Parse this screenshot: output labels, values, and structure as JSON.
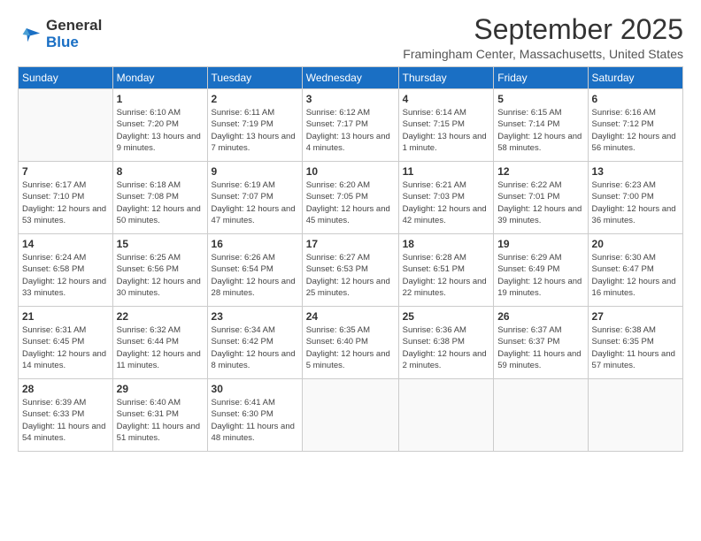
{
  "header": {
    "logo_text_general": "General",
    "logo_text_blue": "Blue",
    "month_title": "September 2025",
    "location": "Framingham Center, Massachusetts, United States"
  },
  "weekdays": [
    "Sunday",
    "Monday",
    "Tuesday",
    "Wednesday",
    "Thursday",
    "Friday",
    "Saturday"
  ],
  "weeks": [
    [
      {
        "day": "",
        "sunrise": "",
        "sunset": "",
        "daylight": ""
      },
      {
        "day": "1",
        "sunrise": "Sunrise: 6:10 AM",
        "sunset": "Sunset: 7:20 PM",
        "daylight": "Daylight: 13 hours and 9 minutes."
      },
      {
        "day": "2",
        "sunrise": "Sunrise: 6:11 AM",
        "sunset": "Sunset: 7:19 PM",
        "daylight": "Daylight: 13 hours and 7 minutes."
      },
      {
        "day": "3",
        "sunrise": "Sunrise: 6:12 AM",
        "sunset": "Sunset: 7:17 PM",
        "daylight": "Daylight: 13 hours and 4 minutes."
      },
      {
        "day": "4",
        "sunrise": "Sunrise: 6:14 AM",
        "sunset": "Sunset: 7:15 PM",
        "daylight": "Daylight: 13 hours and 1 minute."
      },
      {
        "day": "5",
        "sunrise": "Sunrise: 6:15 AM",
        "sunset": "Sunset: 7:14 PM",
        "daylight": "Daylight: 12 hours and 58 minutes."
      },
      {
        "day": "6",
        "sunrise": "Sunrise: 6:16 AM",
        "sunset": "Sunset: 7:12 PM",
        "daylight": "Daylight: 12 hours and 56 minutes."
      }
    ],
    [
      {
        "day": "7",
        "sunrise": "Sunrise: 6:17 AM",
        "sunset": "Sunset: 7:10 PM",
        "daylight": "Daylight: 12 hours and 53 minutes."
      },
      {
        "day": "8",
        "sunrise": "Sunrise: 6:18 AM",
        "sunset": "Sunset: 7:08 PM",
        "daylight": "Daylight: 12 hours and 50 minutes."
      },
      {
        "day": "9",
        "sunrise": "Sunrise: 6:19 AM",
        "sunset": "Sunset: 7:07 PM",
        "daylight": "Daylight: 12 hours and 47 minutes."
      },
      {
        "day": "10",
        "sunrise": "Sunrise: 6:20 AM",
        "sunset": "Sunset: 7:05 PM",
        "daylight": "Daylight: 12 hours and 45 minutes."
      },
      {
        "day": "11",
        "sunrise": "Sunrise: 6:21 AM",
        "sunset": "Sunset: 7:03 PM",
        "daylight": "Daylight: 12 hours and 42 minutes."
      },
      {
        "day": "12",
        "sunrise": "Sunrise: 6:22 AM",
        "sunset": "Sunset: 7:01 PM",
        "daylight": "Daylight: 12 hours and 39 minutes."
      },
      {
        "day": "13",
        "sunrise": "Sunrise: 6:23 AM",
        "sunset": "Sunset: 7:00 PM",
        "daylight": "Daylight: 12 hours and 36 minutes."
      }
    ],
    [
      {
        "day": "14",
        "sunrise": "Sunrise: 6:24 AM",
        "sunset": "Sunset: 6:58 PM",
        "daylight": "Daylight: 12 hours and 33 minutes."
      },
      {
        "day": "15",
        "sunrise": "Sunrise: 6:25 AM",
        "sunset": "Sunset: 6:56 PM",
        "daylight": "Daylight: 12 hours and 30 minutes."
      },
      {
        "day": "16",
        "sunrise": "Sunrise: 6:26 AM",
        "sunset": "Sunset: 6:54 PM",
        "daylight": "Daylight: 12 hours and 28 minutes."
      },
      {
        "day": "17",
        "sunrise": "Sunrise: 6:27 AM",
        "sunset": "Sunset: 6:53 PM",
        "daylight": "Daylight: 12 hours and 25 minutes."
      },
      {
        "day": "18",
        "sunrise": "Sunrise: 6:28 AM",
        "sunset": "Sunset: 6:51 PM",
        "daylight": "Daylight: 12 hours and 22 minutes."
      },
      {
        "day": "19",
        "sunrise": "Sunrise: 6:29 AM",
        "sunset": "Sunset: 6:49 PM",
        "daylight": "Daylight: 12 hours and 19 minutes."
      },
      {
        "day": "20",
        "sunrise": "Sunrise: 6:30 AM",
        "sunset": "Sunset: 6:47 PM",
        "daylight": "Daylight: 12 hours and 16 minutes."
      }
    ],
    [
      {
        "day": "21",
        "sunrise": "Sunrise: 6:31 AM",
        "sunset": "Sunset: 6:45 PM",
        "daylight": "Daylight: 12 hours and 14 minutes."
      },
      {
        "day": "22",
        "sunrise": "Sunrise: 6:32 AM",
        "sunset": "Sunset: 6:44 PM",
        "daylight": "Daylight: 12 hours and 11 minutes."
      },
      {
        "day": "23",
        "sunrise": "Sunrise: 6:34 AM",
        "sunset": "Sunset: 6:42 PM",
        "daylight": "Daylight: 12 hours and 8 minutes."
      },
      {
        "day": "24",
        "sunrise": "Sunrise: 6:35 AM",
        "sunset": "Sunset: 6:40 PM",
        "daylight": "Daylight: 12 hours and 5 minutes."
      },
      {
        "day": "25",
        "sunrise": "Sunrise: 6:36 AM",
        "sunset": "Sunset: 6:38 PM",
        "daylight": "Daylight: 12 hours and 2 minutes."
      },
      {
        "day": "26",
        "sunrise": "Sunrise: 6:37 AM",
        "sunset": "Sunset: 6:37 PM",
        "daylight": "Daylight: 11 hours and 59 minutes."
      },
      {
        "day": "27",
        "sunrise": "Sunrise: 6:38 AM",
        "sunset": "Sunset: 6:35 PM",
        "daylight": "Daylight: 11 hours and 57 minutes."
      }
    ],
    [
      {
        "day": "28",
        "sunrise": "Sunrise: 6:39 AM",
        "sunset": "Sunset: 6:33 PM",
        "daylight": "Daylight: 11 hours and 54 minutes."
      },
      {
        "day": "29",
        "sunrise": "Sunrise: 6:40 AM",
        "sunset": "Sunset: 6:31 PM",
        "daylight": "Daylight: 11 hours and 51 minutes."
      },
      {
        "day": "30",
        "sunrise": "Sunrise: 6:41 AM",
        "sunset": "Sunset: 6:30 PM",
        "daylight": "Daylight: 11 hours and 48 minutes."
      },
      {
        "day": "",
        "sunrise": "",
        "sunset": "",
        "daylight": ""
      },
      {
        "day": "",
        "sunrise": "",
        "sunset": "",
        "daylight": ""
      },
      {
        "day": "",
        "sunrise": "",
        "sunset": "",
        "daylight": ""
      },
      {
        "day": "",
        "sunrise": "",
        "sunset": "",
        "daylight": ""
      }
    ]
  ]
}
